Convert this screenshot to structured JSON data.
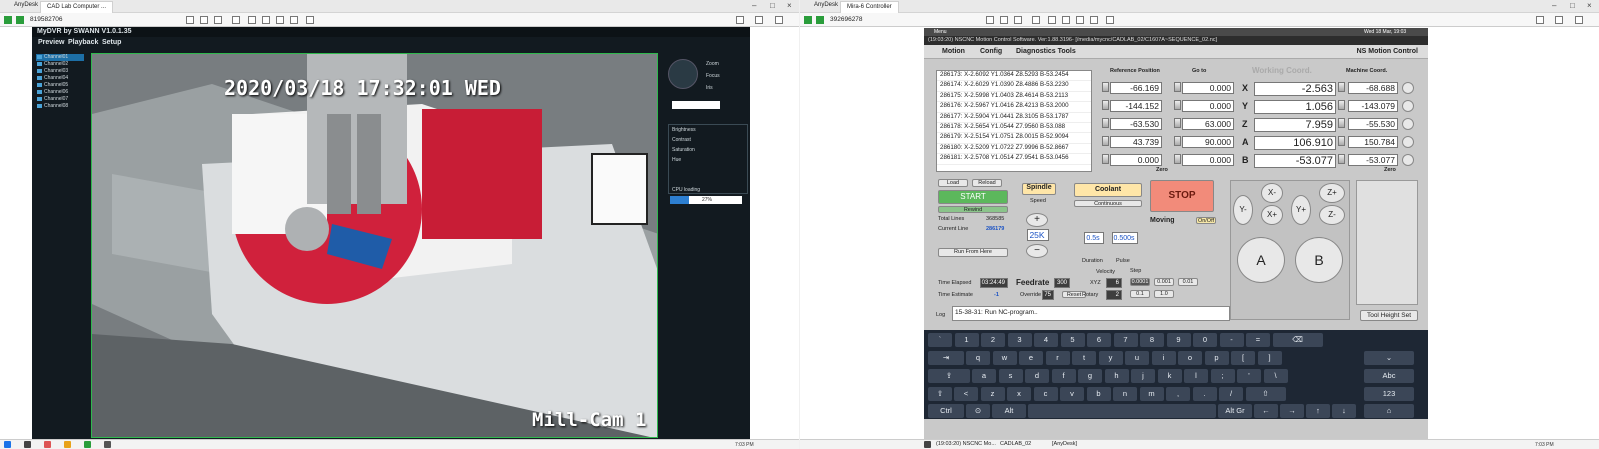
{
  "left": {
    "browser_tabs": [
      "AnyDesk",
      "CAD Lab Computer ..."
    ],
    "session_id": "819582706",
    "app_title": "MyDVR by SWANN   V1.0.1.35",
    "menu": [
      "Preview",
      "Playback",
      "Setup"
    ],
    "channels": [
      "Channel01",
      "Channel02",
      "Channel03",
      "Channel04",
      "Channel05",
      "Channel06",
      "Channel07",
      "Channel08"
    ],
    "osd_timestamp": "2020/03/18  17:32:01 WED",
    "osd_cam": "Mill-Cam 1",
    "ptz_labels": [
      "Zoom",
      "Focus",
      "Iris"
    ],
    "sliders": [
      "Brightness",
      "Contrast",
      "Saturation",
      "Hue"
    ],
    "cpu_label": "CPU loading",
    "cpu_value": "27%",
    "clock": "7:03 PM"
  },
  "right": {
    "browser_tabs": [
      "AnyDesk",
      "Mira-6 Controller"
    ],
    "session_id": "392696278",
    "top_menu": "Menu",
    "top_clock": "Wed 18 Mar, 19:03",
    "title": "(19:03:20)  NSCNC Motion Control Software. Ver:1.88.3196-  [/media/mycnc/CADLAB_02/C1607A~SEQUENCE_02.nc]",
    "menus": [
      "Motion",
      "Config",
      "Diagnostics Tools"
    ],
    "brand": "NS Motion Control",
    "program_lines": [
      "286173: X-2.6092 Y1.0364 Z8.5293 B-53.2454",
      "286174: X-2.6029 Y1.0390 Z8.4886 B-53.2230",
      "286175: X-2.5998 Y1.0403 Z8.4614 B-53.2113",
      "286176: X-2.5967 Y1.0416 Z8.4213 B-53.2000",
      "286177: X-2.5904 Y1.0441 Z8.3105 B-53.1787",
      "286178: X-2.5654 Y1.0544 Z7.9560 B-53.088",
      "286179: X-2.5154 Y1.0751 Z8.0015 B-52.9094",
      "286180: X-2.5209 Y1.0722 Z7.9996 B-52.8667",
      "286181: X-2.5708 Y1.0514 Z7.9541 B-53.0456"
    ],
    "ref_label": "Reference Position",
    "goto_label": "Go to",
    "work_label": "Working Coord.",
    "machine_label": "Machine Coord.",
    "ref": [
      "-66.169",
      "-144.152",
      "-63.530",
      "43.739",
      "0.000"
    ],
    "goto": [
      "0.000",
      "0.000",
      "63.000",
      "90.000",
      "0.000"
    ],
    "axes": [
      "X",
      "Y",
      "Z",
      "A",
      "B"
    ],
    "work": [
      "-2.563",
      "1.056",
      "7.959",
      "106.910",
      "-53.077"
    ],
    "machine": [
      "-68.688",
      "-143.079",
      "-55.530",
      "150.784",
      "-53.077"
    ],
    "zero": "Zero",
    "load": "Load",
    "reload": "Reload",
    "start": "START",
    "rewind": "Rewind",
    "total_lines_label": "Total Lines",
    "total_lines": "368585",
    "current_line_label": "Current Line",
    "current_line": "286179",
    "run_from_here": "Run From Here",
    "spindle": "Spindle",
    "spindle_speed_label": "Speed",
    "spindle_speed": "25K",
    "coolant": "Coolant",
    "continuous": "Continuous",
    "duration": "0.5s",
    "pulse": "0.500s",
    "duration_label": "Duration",
    "pulse_label": "Pulse",
    "stop": "STOP",
    "moving": "Moving",
    "onoff": "On/Off",
    "time_elapsed_label": "Time Elapsed",
    "time_elapsed": "03:24:49",
    "time_estimate_label": "Time Estimate",
    "time_estimate": "-1",
    "feedrate": "Feedrate",
    "feedrate_value": "300",
    "override_label": "Override",
    "override": "75",
    "reset": "Reset",
    "velocity_label": "Velocity",
    "xyz_label": "XYZ",
    "xyz_vel": "6",
    "rotary_label": "Rotary",
    "rotary_vel": "2",
    "step_label": "Step",
    "steps": [
      "0.0001",
      "0.001",
      "0.01",
      "0.1",
      "1.0"
    ],
    "jog_keys": [
      "X-",
      "X+",
      "Y-",
      "Y+",
      "Z+",
      "Z-",
      "A",
      "B"
    ],
    "tool_height": "Tool Height Set",
    "log_label": "Log",
    "log_text": "15-38-31: Run NC-program..",
    "taskbar": [
      "(19:03:20)  NSCNC Mo...",
      "CADLAB_02",
      "[AnyDesk]"
    ],
    "clock": "7:03 PM"
  },
  "keyboard": {
    "row1": [
      "`",
      "1",
      "2",
      "3",
      "4",
      "5",
      "6",
      "7",
      "8",
      "9",
      "0",
      "-",
      "="
    ],
    "row2": [
      "q",
      "w",
      "e",
      "r",
      "t",
      "y",
      "u",
      "i",
      "o",
      "p",
      "[",
      "]"
    ],
    "row3": [
      "a",
      "s",
      "d",
      "f",
      "g",
      "h",
      "j",
      "k",
      "l",
      ";",
      "'",
      "\\"
    ],
    "row4": [
      "<",
      "z",
      "x",
      "c",
      "v",
      "b",
      "n",
      "m",
      ",",
      ".",
      "/"
    ],
    "ctrl": "Ctrl",
    "alt": "Alt",
    "altgr": "Alt Gr",
    "abc": "Abc",
    "n123": "123"
  }
}
